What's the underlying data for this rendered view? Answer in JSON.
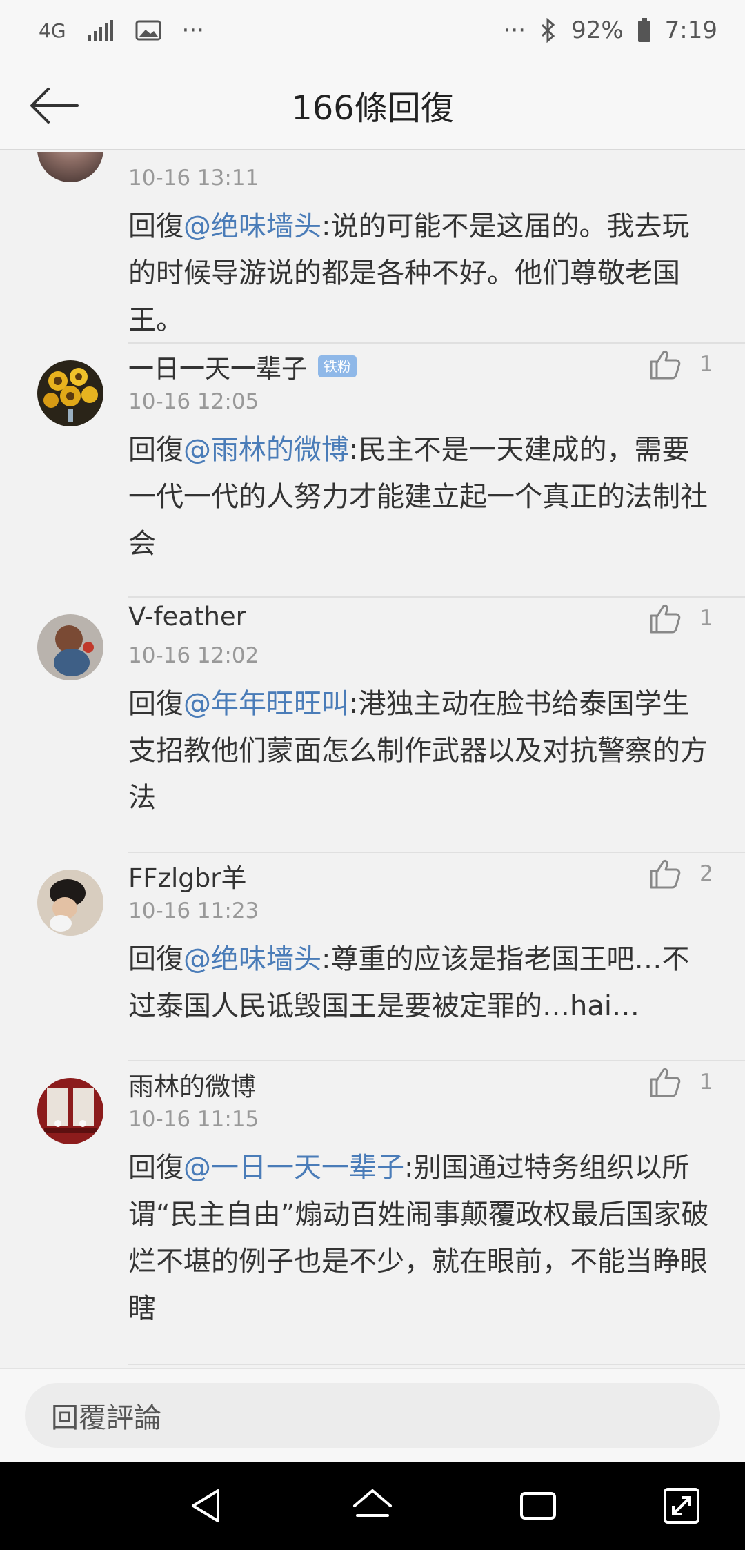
{
  "status": {
    "network": "4G",
    "more_left": "···",
    "more_right": "···",
    "battery": "92%",
    "time": "7:19"
  },
  "header": {
    "title": "166條回復"
  },
  "comments": [
    {
      "time": "10-16 13:11",
      "prefix": "回復",
      "mention": "@绝味墙头",
      "text": ":说的可能不是这届的。我去玩的时候导游说的都是各种不好。他们尊敬老国王。"
    },
    {
      "name": "一日一天一辈子",
      "badge": "铁粉",
      "time": "10-16 12:05",
      "likes": "1",
      "prefix": "回復",
      "mention": "@雨林的微博",
      "text": ":民主不是一天建成的，需要一代一代的人努力才能建立起一个真正的法制社会"
    },
    {
      "name": "V-feather",
      "time": "10-16 12:02",
      "likes": "1",
      "prefix": "回復",
      "mention": "@年年旺旺叫",
      "text": ":港独主动在脸书给泰国学生支招教他们蒙面怎么制作武器以及对抗警察的方法"
    },
    {
      "name": "FFzlgbr羊",
      "time": "10-16 11:23",
      "likes": "2",
      "prefix": "回復",
      "mention": "@绝味墙头",
      "text": ":尊重的应该是指老国王吧…不过泰国人民诋毁国王是要被定罪的…hai…"
    },
    {
      "name": "雨林的微博",
      "time": "10-16 11:15",
      "likes": "1",
      "prefix": "回復",
      "mention": "@一日一天一辈子",
      "text": ":别国通过特务组织以所谓“民主自由”煽动百姓闹事颠覆政权最后国家破烂不堪的例子也是不少，就在眼前，不能当睁眼瞎"
    }
  ],
  "reply_bar": {
    "placeholder": "回覆評論"
  }
}
